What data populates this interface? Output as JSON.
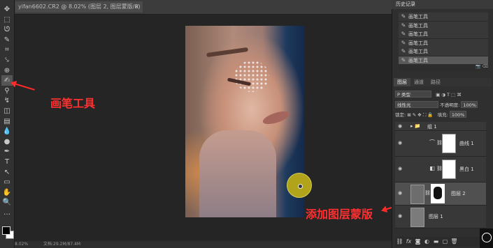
{
  "document": {
    "tab_title": "yifan6602.CR2 @ 8.02% (图层 2, 图层蒙版/8)",
    "close_glyph": "×"
  },
  "toolbar": {
    "tools": [
      {
        "icon": "move-icon",
        "glyph": "✥"
      },
      {
        "icon": "marquee-icon",
        "glyph": "⬚"
      },
      {
        "icon": "lasso-icon",
        "glyph": "ᘎ"
      },
      {
        "icon": "quick-select-icon",
        "glyph": "✎"
      },
      {
        "icon": "crop-icon",
        "glyph": "⌗"
      },
      {
        "icon": "eyedropper-icon",
        "glyph": "⤥"
      },
      {
        "icon": "healing-icon",
        "glyph": "⊕"
      },
      {
        "icon": "brush-icon",
        "glyph": "✍"
      },
      {
        "icon": "stamp-icon",
        "glyph": "⚲"
      },
      {
        "icon": "history-brush-icon",
        "glyph": "↯"
      },
      {
        "icon": "eraser-icon",
        "glyph": "◫"
      },
      {
        "icon": "gradient-icon",
        "glyph": "▤"
      },
      {
        "icon": "blur-icon",
        "glyph": "💧"
      },
      {
        "icon": "dodge-icon",
        "glyph": "●"
      },
      {
        "icon": "pen-icon",
        "glyph": "✒"
      },
      {
        "icon": "type-icon",
        "glyph": "T"
      },
      {
        "icon": "path-select-icon",
        "glyph": "↖"
      },
      {
        "icon": "shape-icon",
        "glyph": "▭"
      },
      {
        "icon": "hand-icon",
        "glyph": "✋"
      },
      {
        "icon": "zoom-icon",
        "glyph": "🔍"
      },
      {
        "icon": "more-icon",
        "glyph": "…"
      }
    ],
    "fg_color": "#000000",
    "bg_color": "#ffffff"
  },
  "annotations": {
    "brush_tool": "画笔工具",
    "add_mask": "添加图层蒙版",
    "color": "#ff2a2a"
  },
  "status": {
    "zoom": "8.02%",
    "doc": "文档:29.2M/87.4M"
  },
  "history": {
    "title": "历史记录",
    "items": [
      "画笔工具",
      "画笔工具",
      "画笔工具",
      "画笔工具",
      "画笔工具",
      "画笔工具"
    ]
  },
  "layers_panel": {
    "tabs": [
      "图层",
      "通道",
      "路径"
    ],
    "filter": "P 类型",
    "blend_mode": "线性光",
    "opacity_label": "不透明度:",
    "opacity": "100%",
    "lock_label": "锁定:",
    "fill_label": "填充:",
    "fill": "100%",
    "group_name": "组 1",
    "layers": [
      {
        "name": "曲线 1"
      },
      {
        "name": "黑白 1"
      },
      {
        "name": "图层 2"
      },
      {
        "name": "图层 1"
      }
    ],
    "footer_icons": [
      "link-icon",
      "fx-icon",
      "mask-icon",
      "adjustment-icon",
      "folder-icon",
      "new-layer-icon",
      "trash-icon"
    ],
    "fx_text": "fx"
  }
}
